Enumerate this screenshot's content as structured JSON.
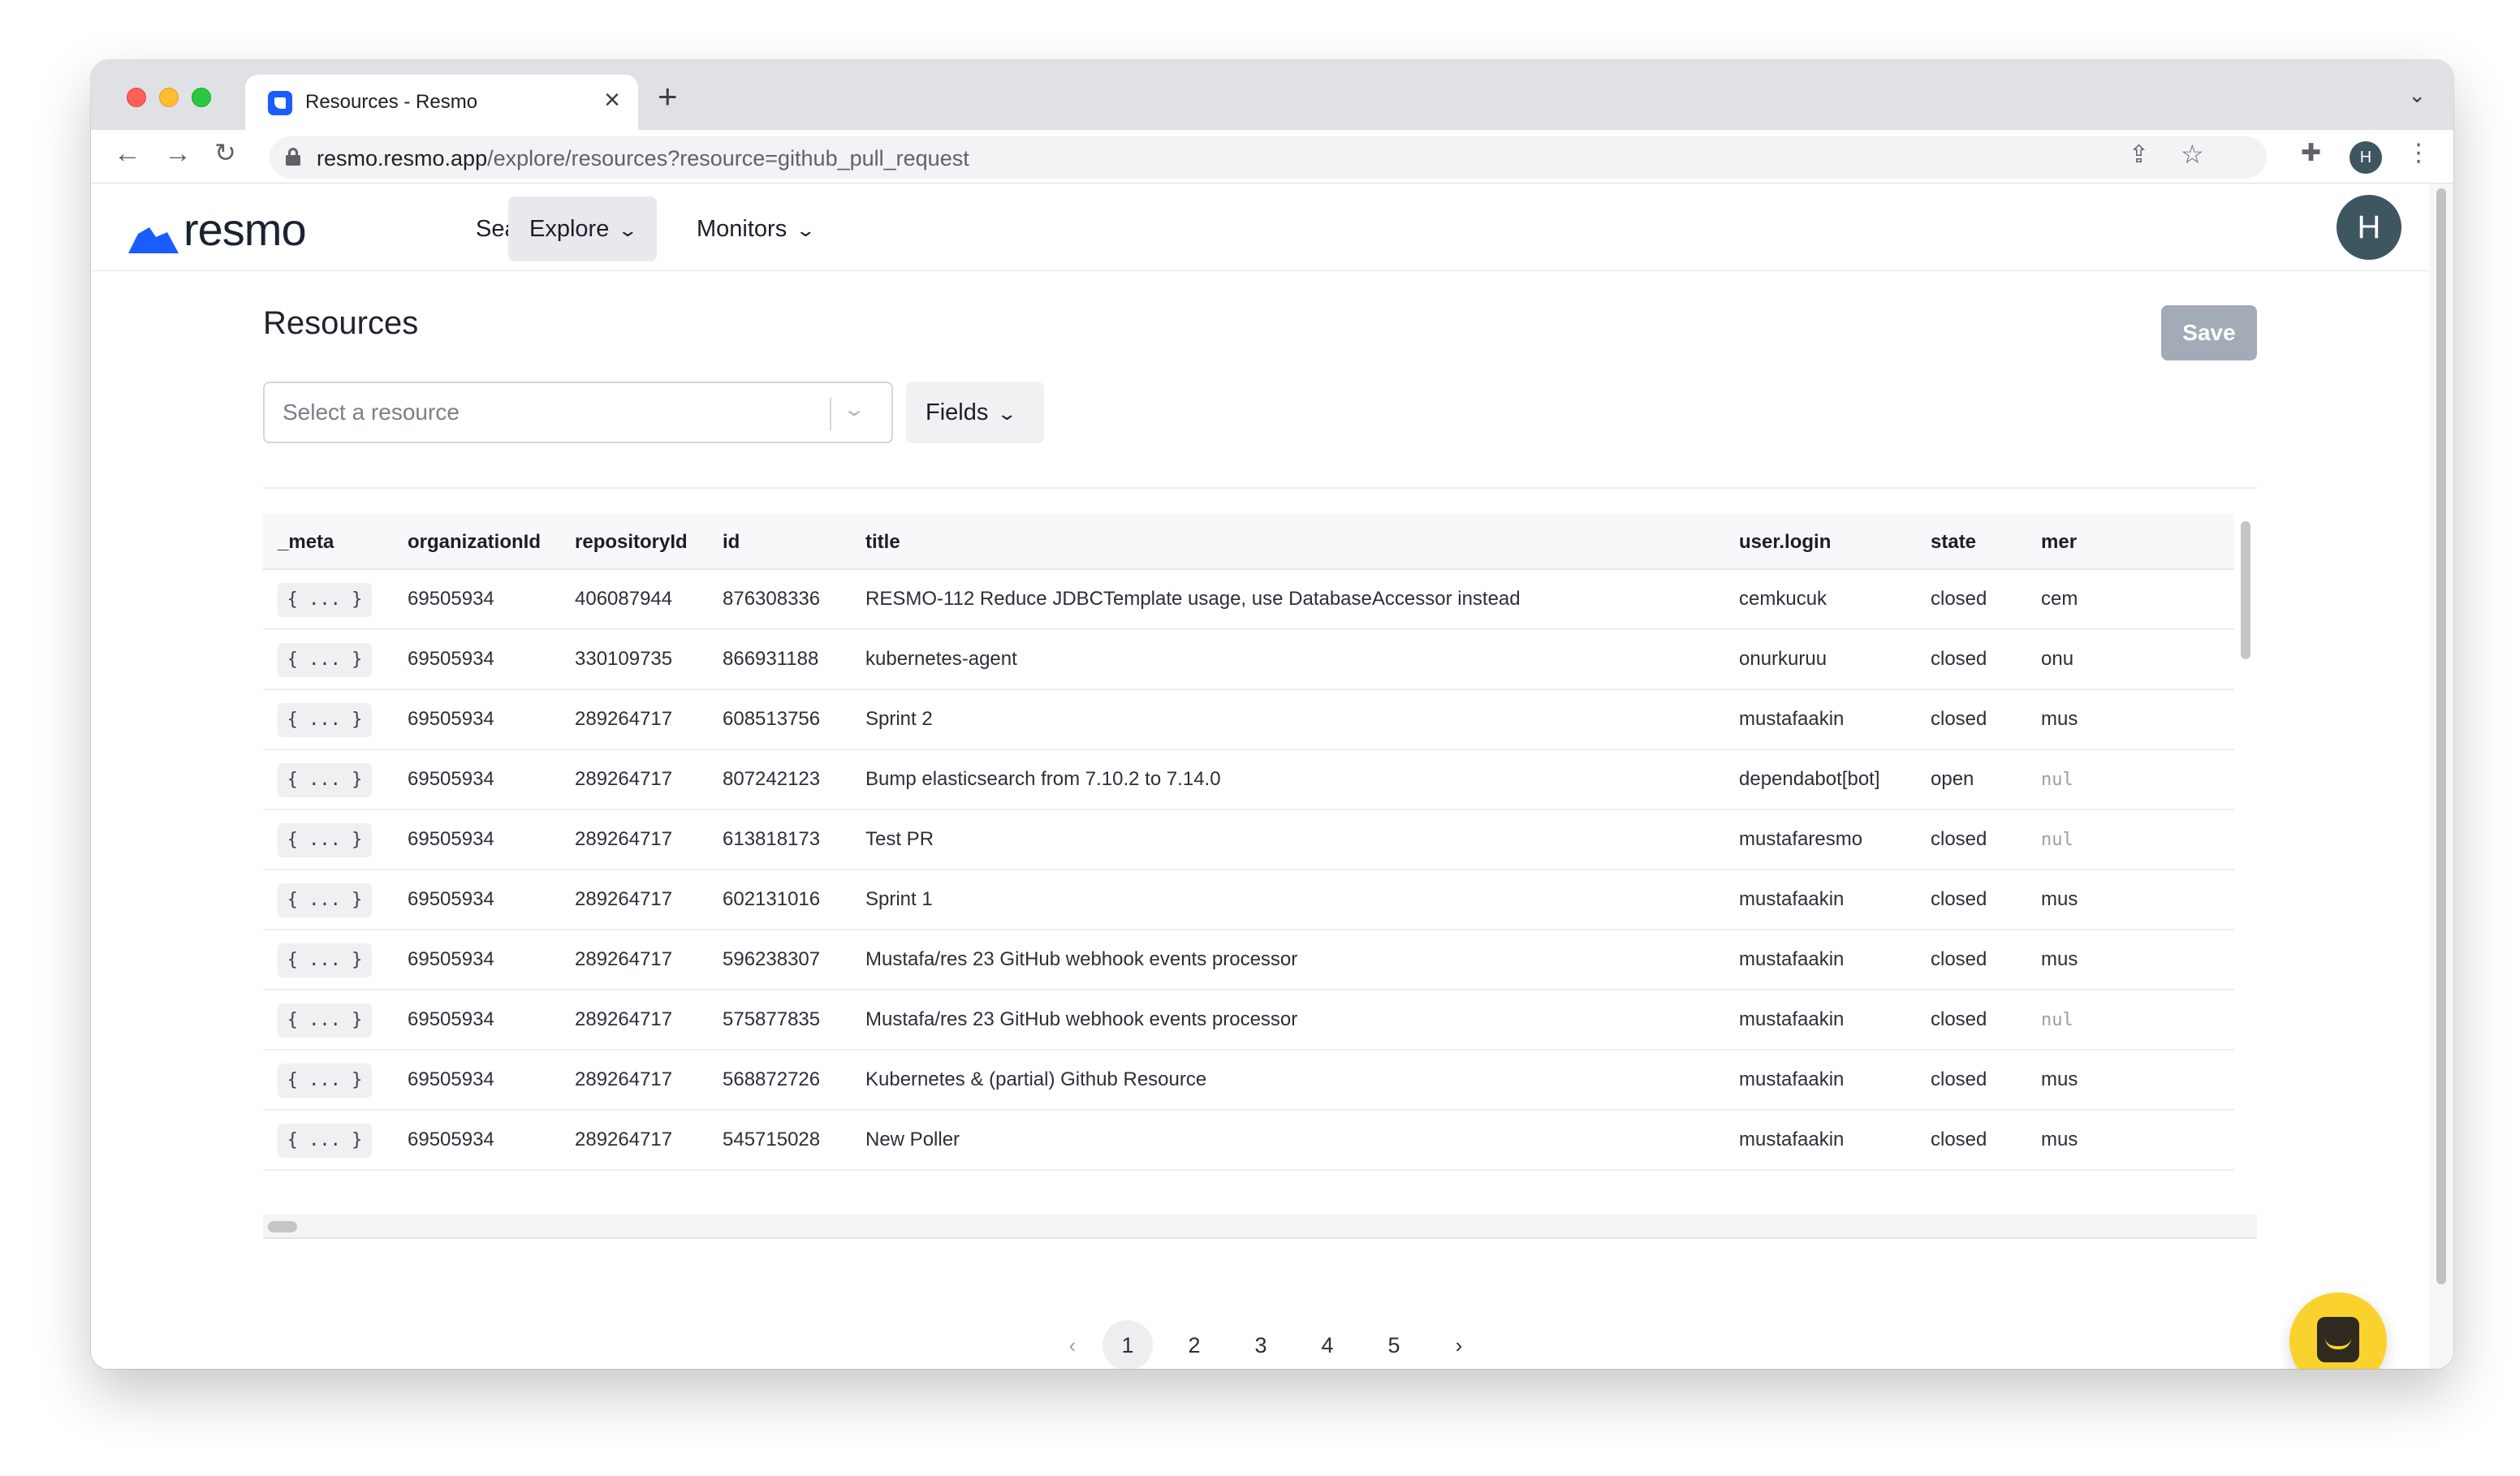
{
  "browser": {
    "tab_title": "Resources - Resmo",
    "tab_close": "×",
    "new_tab": "+",
    "url_host": "resmo.resmo.app",
    "url_rest": "/explore/resources?resource=github_pull_request",
    "profile_initial": "H"
  },
  "app": {
    "logo_text": "resmo",
    "nav": {
      "search": "Search",
      "explore": "Explore",
      "monitors": "Monitors"
    },
    "avatar_initial": "H",
    "accent_color": "#1a5cff"
  },
  "page": {
    "title": "Resources",
    "save_label": "Save",
    "select_placeholder": "Select a resource",
    "fields_label": "Fields"
  },
  "table": {
    "columns": [
      "_meta",
      "organizationId",
      "repositoryId",
      "id",
      "title",
      "user.login",
      "state",
      "mer"
    ],
    "rows": [
      {
        "meta": "{ ... }",
        "organizationId": "69505934",
        "repositoryId": "406087944",
        "id": "876308336",
        "title": "RESMO-112 Reduce JDBCTemplate usage, use DatabaseAccessor instead",
        "user_login": "cemkucuk",
        "state": "closed",
        "mer": "cem"
      },
      {
        "meta": "{ ... }",
        "organizationId": "69505934",
        "repositoryId": "330109735",
        "id": "866931188",
        "title": "kubernetes-agent",
        "user_login": "onurkuruu",
        "state": "closed",
        "mer": "onu"
      },
      {
        "meta": "{ ... }",
        "organizationId": "69505934",
        "repositoryId": "289264717",
        "id": "608513756",
        "title": "Sprint 2",
        "user_login": "mustafaakin",
        "state": "closed",
        "mer": "mus"
      },
      {
        "meta": "{ ... }",
        "organizationId": "69505934",
        "repositoryId": "289264717",
        "id": "807242123",
        "title": "Bump elasticsearch from 7.10.2 to 7.14.0",
        "user_login": "dependabot[bot]",
        "state": "open",
        "mer": "nul"
      },
      {
        "meta": "{ ... }",
        "organizationId": "69505934",
        "repositoryId": "289264717",
        "id": "613818173",
        "title": "Test PR",
        "user_login": "mustafaresmo",
        "state": "closed",
        "mer": "nul"
      },
      {
        "meta": "{ ... }",
        "organizationId": "69505934",
        "repositoryId": "289264717",
        "id": "602131016",
        "title": "Sprint 1",
        "user_login": "mustafaakin",
        "state": "closed",
        "mer": "mus"
      },
      {
        "meta": "{ ... }",
        "organizationId": "69505934",
        "repositoryId": "289264717",
        "id": "596238307",
        "title": "Mustafa/res 23 GitHub webhook events processor",
        "user_login": "mustafaakin",
        "state": "closed",
        "mer": "mus"
      },
      {
        "meta": "{ ... }",
        "organizationId": "69505934",
        "repositoryId": "289264717",
        "id": "575877835",
        "title": "Mustafa/res 23 GitHub webhook events processor",
        "user_login": "mustafaakin",
        "state": "closed",
        "mer": "nul"
      },
      {
        "meta": "{ ... }",
        "organizationId": "69505934",
        "repositoryId": "289264717",
        "id": "568872726",
        "title": "Kubernetes & (partial) Github Resource",
        "user_login": "mustafaakin",
        "state": "closed",
        "mer": "mus"
      },
      {
        "meta": "{ ... }",
        "organizationId": "69505934",
        "repositoryId": "289264717",
        "id": "545715028",
        "title": "New Poller",
        "user_login": "mustafaakin",
        "state": "closed",
        "mer": "mus"
      }
    ]
  },
  "pagination": {
    "prev": "‹",
    "pages": [
      "1",
      "2",
      "3",
      "4",
      "5"
    ],
    "current": "1",
    "next": "›"
  }
}
